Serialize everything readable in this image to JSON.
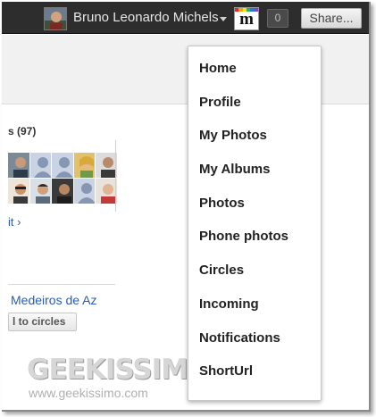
{
  "topbar": {
    "user_name": "Bruno Leonardo Michels",
    "m_button_label": "m",
    "m_colors": [
      "#e32b2b",
      "#f2a31b",
      "#f5e11c",
      "#36b24a",
      "#2b76d6",
      "#8a3fc6"
    ],
    "notification_count": "0",
    "share_label": "Share..."
  },
  "menu": {
    "items": [
      "Home",
      "Profile",
      "My Photos",
      "My Albums",
      "Photos",
      "Phone photos",
      "Circles",
      "Incoming",
      "Notifications",
      "ShortUrl"
    ]
  },
  "sidebar": {
    "circles_heading": "s (97)",
    "edit_link": "it ›",
    "person_name": "Medeiros de Az",
    "add_to_circles": "l to circles",
    "avatar_grid": [
      [
        "photo",
        "silhouette",
        "silhouette",
        "photo",
        "photo"
      ],
      [
        "photo",
        "photo",
        "photo",
        "silhouette",
        "photo"
      ]
    ]
  },
  "watermark": {
    "logo_text": "GEEKISSIMO",
    "url": "www.geekissimo.com"
  },
  "colors": {
    "topbar_bg": "#2d2d2d",
    "link": "#2a5db0"
  }
}
